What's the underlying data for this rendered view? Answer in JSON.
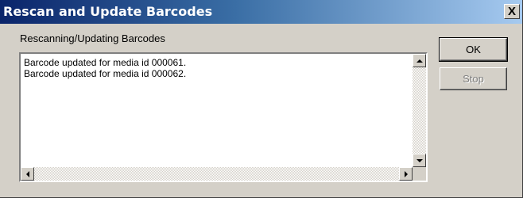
{
  "window": {
    "title": "Rescan and Update Barcodes",
    "close_glyph": "X"
  },
  "group_label": "Rescanning/Updating Barcodes",
  "log": {
    "lines": [
      "Barcode updated for media id 000061.",
      "Barcode updated for media id 000062."
    ]
  },
  "buttons": {
    "ok_label": "OK",
    "stop_label": "Stop",
    "stop_enabled": false
  },
  "colors": {
    "title_gradient_start": "#0a246a",
    "title_gradient_end": "#a6caf0",
    "face": "#d4d0c8"
  },
  "icons": {
    "close": "close-icon",
    "scroll_up": "arrow-up-icon",
    "scroll_down": "arrow-down-icon",
    "scroll_left": "arrow-left-icon",
    "scroll_right": "arrow-right-icon"
  }
}
